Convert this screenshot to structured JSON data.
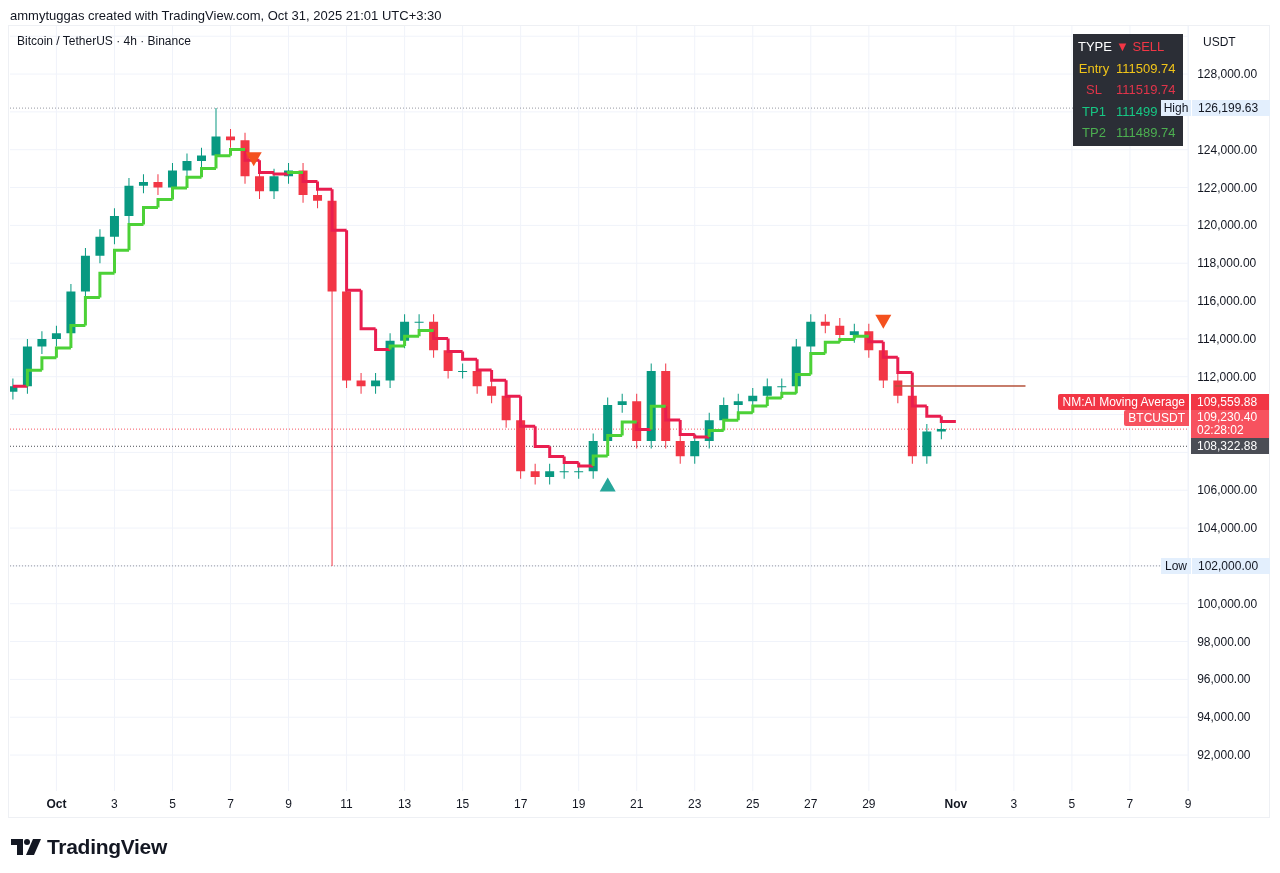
{
  "header": {
    "credit": "ammytuggas created with TradingView.com, Oct 31, 2025 21:01 UTC+3:30"
  },
  "chart": {
    "title": "Bitcoin / TetherUS · 4h · Binance",
    "currency": "USDT",
    "price_axis": [
      "128,000.00",
      "124,000.00",
      "122,000.00",
      "120,000.00",
      "118,000.00",
      "116,000.00",
      "114,000.00",
      "112,000.00",
      "106,000.00",
      "104,000.00",
      "100,000.00",
      "98,000.00",
      "96,000.00",
      "94,000.00",
      "92,000.00"
    ],
    "time_axis": [
      {
        "kind": "month",
        "label": "Oct"
      },
      {
        "kind": "day",
        "label": "3"
      },
      {
        "kind": "day",
        "label": "5"
      },
      {
        "kind": "day",
        "label": "7"
      },
      {
        "kind": "day",
        "label": "9"
      },
      {
        "kind": "day",
        "label": "11"
      },
      {
        "kind": "day",
        "label": "13"
      },
      {
        "kind": "day",
        "label": "15"
      },
      {
        "kind": "day",
        "label": "17"
      },
      {
        "kind": "day",
        "label": "19"
      },
      {
        "kind": "day",
        "label": "21"
      },
      {
        "kind": "day",
        "label": "23"
      },
      {
        "kind": "day",
        "label": "25"
      },
      {
        "kind": "day",
        "label": "27"
      },
      {
        "kind": "day",
        "label": "29"
      },
      {
        "kind": "month",
        "label": "Nov"
      },
      {
        "kind": "day",
        "label": "3"
      },
      {
        "kind": "day",
        "label": "5"
      },
      {
        "kind": "day",
        "label": "7"
      },
      {
        "kind": "day",
        "label": "9"
      }
    ],
    "markers": [
      {
        "label": "High",
        "value": "126,199.63"
      },
      {
        "label": "Low",
        "value": "102,000.00"
      }
    ],
    "signal_table": [
      {
        "kind": "header",
        "label": "TYPE",
        "value": "▼ SELL",
        "color": "#f23645"
      },
      {
        "kind": "level",
        "label": "Entry",
        "value": "111509.74",
        "color": "#f0c419"
      },
      {
        "kind": "level",
        "label": "SL",
        "value": "111519.74",
        "color": "#e0344a"
      },
      {
        "kind": "level",
        "label": "TP1",
        "value": "111499",
        "color": "#16c784"
      },
      {
        "kind": "level",
        "label": "TP2",
        "value": "111489.74",
        "color": "#4caf50"
      }
    ],
    "price_tags": [
      {
        "kind": "indicator",
        "name": "NM:AI Moving Average",
        "value": "109,559.88",
        "color": "#f23645"
      },
      {
        "kind": "last_price",
        "name": "BTCUSDT",
        "value": "109,230.40",
        "countdown": "02:28:02",
        "color": "#f7525f"
      },
      {
        "kind": "level",
        "value": "108,322.88",
        "color": "#4a4d55"
      }
    ]
  },
  "footer": {
    "brand": "TradingView"
  }
}
